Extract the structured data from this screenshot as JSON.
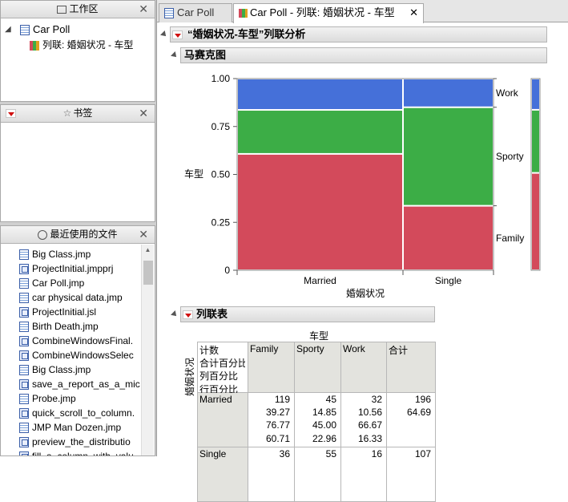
{
  "workspace": {
    "title": "工作区",
    "root": "Car Poll",
    "child": "列联: 婚姻状况 - 车型"
  },
  "bookmarks": {
    "title": "书签"
  },
  "recent": {
    "title": "最近使用的文件",
    "files": [
      "Big Class.jmp",
      "ProjectInitial.jmpprj",
      "Car Poll.jmp",
      "car physical data.jmp",
      "ProjectInitial.jsl",
      "Birth Death.jmp",
      "CombineWindowsFinal.",
      "CombineWindowsSelec",
      "Big Class.jmp",
      "save_a_report_as_a_mic",
      "Probe.jmp",
      "quick_scroll_to_column.",
      "JMP Man Dozen.jmp",
      "preview_the_distributio",
      "fill_a_column_with_valu"
    ]
  },
  "tabs": [
    {
      "label": "Car Poll"
    },
    {
      "label": "Car Poll - 列联: 婚姻状况 - 车型"
    }
  ],
  "report": {
    "title": "“婚姻状况-车型”列联分析",
    "mosaic_title": "马赛克图",
    "table_title": "列联表"
  },
  "colors": {
    "Family": "#d34a5b",
    "Sporty": "#3cad46",
    "Work": "#4570d9"
  },
  "chart_data": {
    "type": "mosaic",
    "xlabel": "婚姻状况",
    "ylabel": "车型",
    "yticks": [
      "1.00",
      "0.75",
      "0.50",
      "0.25",
      "0"
    ],
    "categories": [
      "Married",
      "Single"
    ],
    "column_shares": [
      0.6469,
      0.3531
    ],
    "series": [
      {
        "name": "Family",
        "values": [
          0.6071,
          0.3364
        ]
      },
      {
        "name": "Sporty",
        "values": [
          0.2296,
          0.514
        ]
      },
      {
        "name": "Work",
        "values": [
          0.1633,
          0.1495
        ]
      }
    ],
    "overall": {
      "Family": 0.5079,
      "Sporty": 0.3293,
      "Work": 0.1628
    }
  },
  "crosstab": {
    "col_var": "车型",
    "row_var": "婚姻状况",
    "stat_labels": [
      "计数",
      "合计百分比",
      "列百分比",
      "行百分比"
    ],
    "columns": [
      "Family",
      "Sporty",
      "Work",
      "合计"
    ],
    "rows": [
      {
        "label": "Married",
        "cells": [
          [
            "119",
            "39.27",
            "76.77",
            "60.71"
          ],
          [
            "45",
            "14.85",
            "45.00",
            "22.96"
          ],
          [
            "32",
            "10.56",
            "66.67",
            "16.33"
          ],
          [
            "196",
            "64.69",
            "",
            ""
          ]
        ]
      },
      {
        "label": "Single",
        "cells": [
          [
            "36"
          ],
          [
            "55"
          ],
          [
            "16"
          ],
          [
            "107"
          ]
        ]
      }
    ]
  }
}
